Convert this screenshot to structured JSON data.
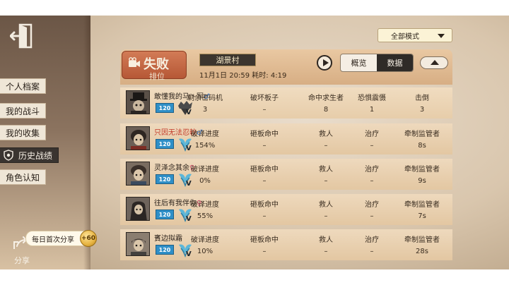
{
  "sidebar": {
    "items": [
      {
        "label": "个人档案",
        "active": false
      },
      {
        "label": "我的战斗",
        "active": false
      },
      {
        "label": "我的收集",
        "active": false
      },
      {
        "label": "历史战绩",
        "active": true
      },
      {
        "label": "角色认知",
        "active": false
      }
    ],
    "share_label": "分享",
    "daily_share_bubble": "每日首次分享",
    "coin_value": "+60"
  },
  "mode_select": {
    "value": "全部模式"
  },
  "header": {
    "result": "失败",
    "mode": "排位",
    "map": "湖景村",
    "datetime": "11月1日 20:59",
    "duration_label": "耗时:",
    "duration": "4:19"
  },
  "tabs": [
    {
      "label": "概览",
      "active": false
    },
    {
      "label": "数据",
      "active": true
    }
  ],
  "players": [
    {
      "name": "敢懂我的马丶军",
      "gender": "♂",
      "level": "120",
      "role": "hunter",
      "highlight": false,
      "labels": [
        "剩余密码机",
        "破坏板子",
        "命中求生者",
        "恐惧震慑",
        "击倒"
      ],
      "values": [
        "3",
        "–",
        "8",
        "1",
        "3"
      ]
    },
    {
      "name": "只因无法忍較",
      "gender": "♂",
      "level": "120",
      "role": "survivor",
      "highlight": true,
      "labels": [
        "破译进度",
        "砸板命中",
        "救人",
        "治疗",
        "牵制监管者"
      ],
      "values": [
        "154%",
        "–",
        "–",
        "–",
        "8s"
      ]
    },
    {
      "name": "灵泽念其余",
      "gender": "♀",
      "level": "120",
      "role": "survivor",
      "highlight": false,
      "labels": [
        "破译进度",
        "砸板命中",
        "救人",
        "治疗",
        "牵制监管者"
      ],
      "values": [
        "0%",
        "–",
        "–",
        "–",
        "9s"
      ]
    },
    {
      "name": "往后有我伴你",
      "gender": "♀",
      "level": "120",
      "role": "survivor",
      "highlight": false,
      "labels": [
        "破译进度",
        "砸板命中",
        "救人",
        "治疗",
        "牵制监管者"
      ],
      "values": [
        "55%",
        "–",
        "–",
        "–",
        "7s"
      ]
    },
    {
      "name": "賓边拟霜",
      "gender": "",
      "level": "120",
      "role": "survivor",
      "highlight": false,
      "labels": [
        "破译进度",
        "砸板命中",
        "救人",
        "治疗",
        "牵制监管者"
      ],
      "values": [
        "10%",
        "–",
        "–",
        "–",
        "28s"
      ]
    }
  ],
  "colors": {
    "panel": "#e3c7a2",
    "result_badge": "#b65836",
    "level_badge": "#2f8fc7",
    "highlight_name": "#c33b2a"
  }
}
